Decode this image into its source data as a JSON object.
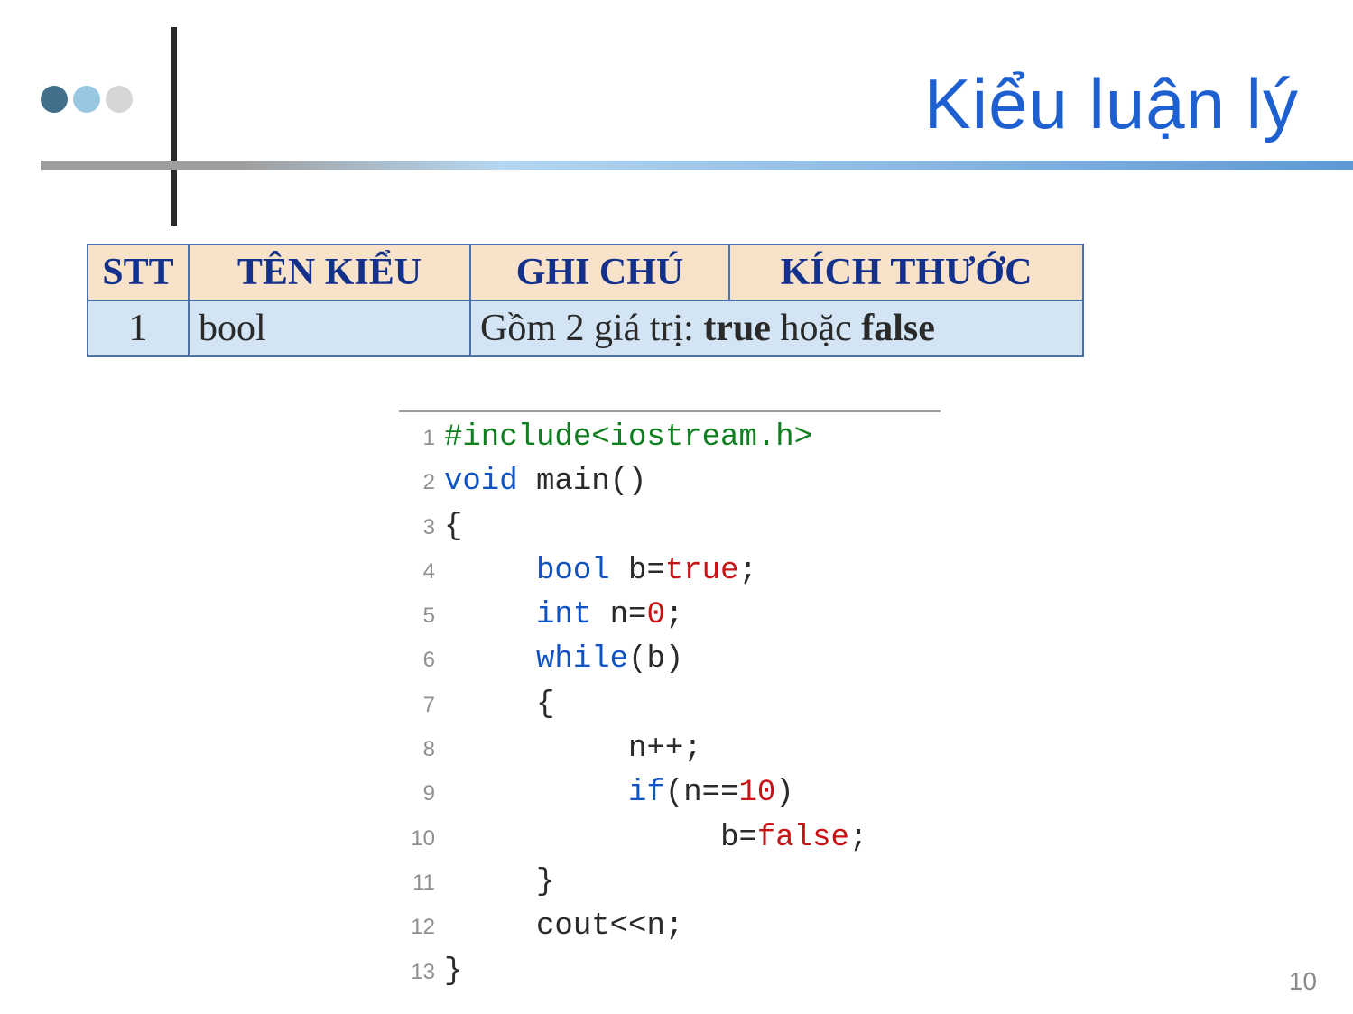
{
  "title": "Kiểu luận lý",
  "table": {
    "headers": {
      "stt": "STT",
      "ten": "TÊN KIỂU",
      "ghi": "GHI CHÚ",
      "kich": "KÍCH THƯỚC"
    },
    "row": {
      "stt": "1",
      "ten": "bool",
      "note_prefix": "Gồm 2 giá trị: ",
      "note_v1": "true",
      "note_mid": " hoặc ",
      "note_v2": "false"
    }
  },
  "code": {
    "l1": {
      "ln": "1",
      "a": "#include<iostream.h>"
    },
    "l2": {
      "ln": "2",
      "a": "void",
      "b": " main()"
    },
    "l3": {
      "ln": "3",
      "a": "{"
    },
    "l4": {
      "ln": "4",
      "pad": "     ",
      "a": "bool",
      "b": " b=",
      "c": "true",
      "d": ";"
    },
    "l5": {
      "ln": "5",
      "pad": "     ",
      "a": "int",
      "b": " n=",
      "c": "0",
      "d": ";"
    },
    "l6": {
      "ln": "6",
      "pad": "     ",
      "a": "while",
      "b": "(b)"
    },
    "l7": {
      "ln": "7",
      "pad": "     ",
      "a": "{"
    },
    "l8": {
      "ln": "8",
      "pad": "          ",
      "a": "n++;"
    },
    "l9": {
      "ln": "9",
      "pad": "          ",
      "a": "if",
      "b": "(n==",
      "c": "10",
      "d": ")"
    },
    "l10": {
      "ln": "10",
      "pad": "               ",
      "a": "b=",
      "b": "false",
      "c": ";"
    },
    "l11": {
      "ln": "11",
      "pad": "     ",
      "a": "}"
    },
    "l12": {
      "ln": "12",
      "pad": "     ",
      "a": "cout<<n;"
    },
    "l13": {
      "ln": "13",
      "a": "}"
    }
  },
  "page_number": "10"
}
